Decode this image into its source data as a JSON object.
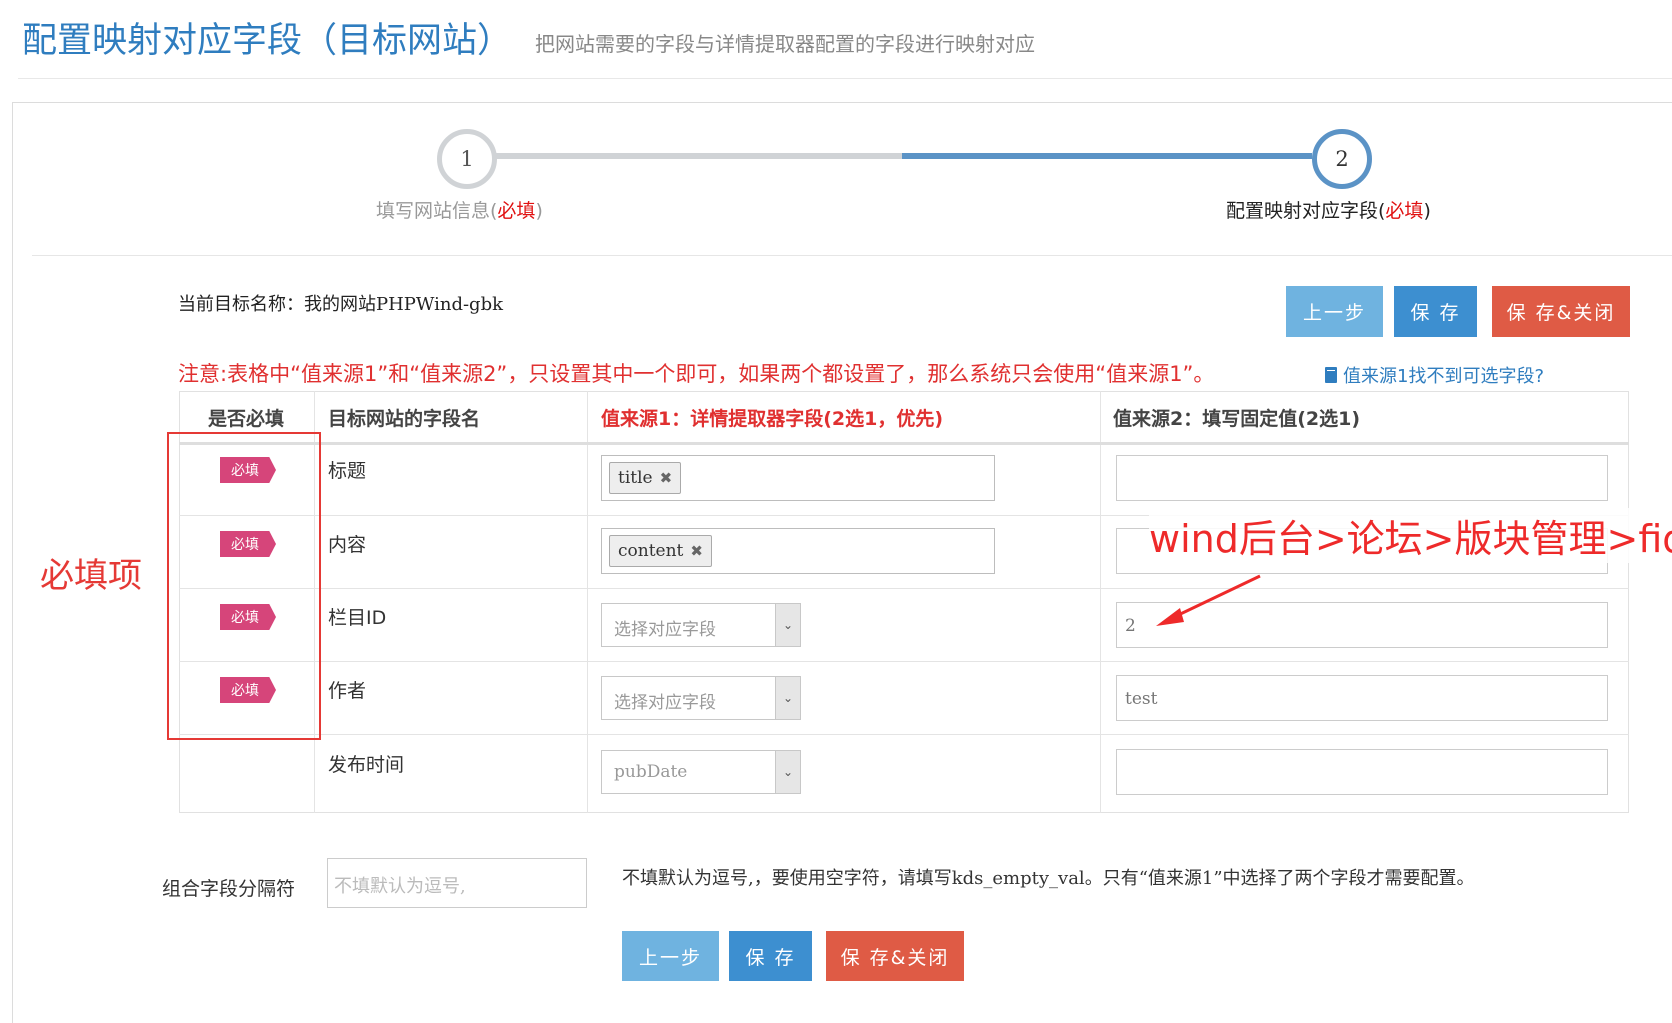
{
  "header": {
    "title": "配置映射对应字段（目标网站）",
    "subtitle": "把网站需要的字段与详情提取器配置的字段进行映射对应"
  },
  "wizard": {
    "steps": [
      {
        "number": "1",
        "label": "填写网站信息(",
        "required": "必填",
        "suffix": ")"
      },
      {
        "number": "2",
        "label": "配置映射对应字段(",
        "required": "必填",
        "suffix": ")"
      }
    ],
    "active_step": 2
  },
  "target": {
    "label": "当前目标名称：我的网站PHPWind-gbk"
  },
  "buttons": {
    "prev": "上一步",
    "save": "保 存",
    "save_close": "保 存&关闭"
  },
  "notice": "注意:表格中“值来源1”和“值来源2”，只设置其中一个即可，如果两个都设置了，那么系统只会使用“值来源1”。",
  "help_link": "值来源1找不到可选字段?",
  "table": {
    "headers": {
      "required": "是否必填",
      "field": "目标网站的字段名",
      "source1": "值来源1：详情提取器字段(2选1，优先)",
      "source2": "值来源2：填写固定值(2选1)"
    },
    "required_badge": "必填",
    "rows": [
      {
        "label": "标题",
        "tag": "title",
        "fixed": ""
      },
      {
        "label": "内容",
        "tag": "content",
        "fixed": ""
      },
      {
        "label": "栏目ID",
        "select": "选择对应字段",
        "fixed": "2"
      },
      {
        "label": "作者",
        "select": "选择对应字段",
        "fixed": "test"
      },
      {
        "label": "发布时间",
        "select": "pubDate",
        "fixed": ""
      }
    ],
    "tag_remove": "✖",
    "select_arrow": "⌄"
  },
  "annotations": {
    "required_note": "必填项",
    "fid_note": "wind后台>论坛>版块管理>fid",
    "color": "#e53935"
  },
  "separator": {
    "label": "组合字段分隔符",
    "placeholder": "不填默认为逗号,",
    "hint": "不填默认为逗号,，要使用空字符，请填写kds_empty_val。只有“值来源1”中选择了两个字段才需要配置。"
  },
  "colors": {
    "accent": "#2f7dbf",
    "badge": "#d6457a",
    "danger": "#df5b45",
    "primary": "#3d8fd0",
    "light": "#6fb3e0"
  }
}
